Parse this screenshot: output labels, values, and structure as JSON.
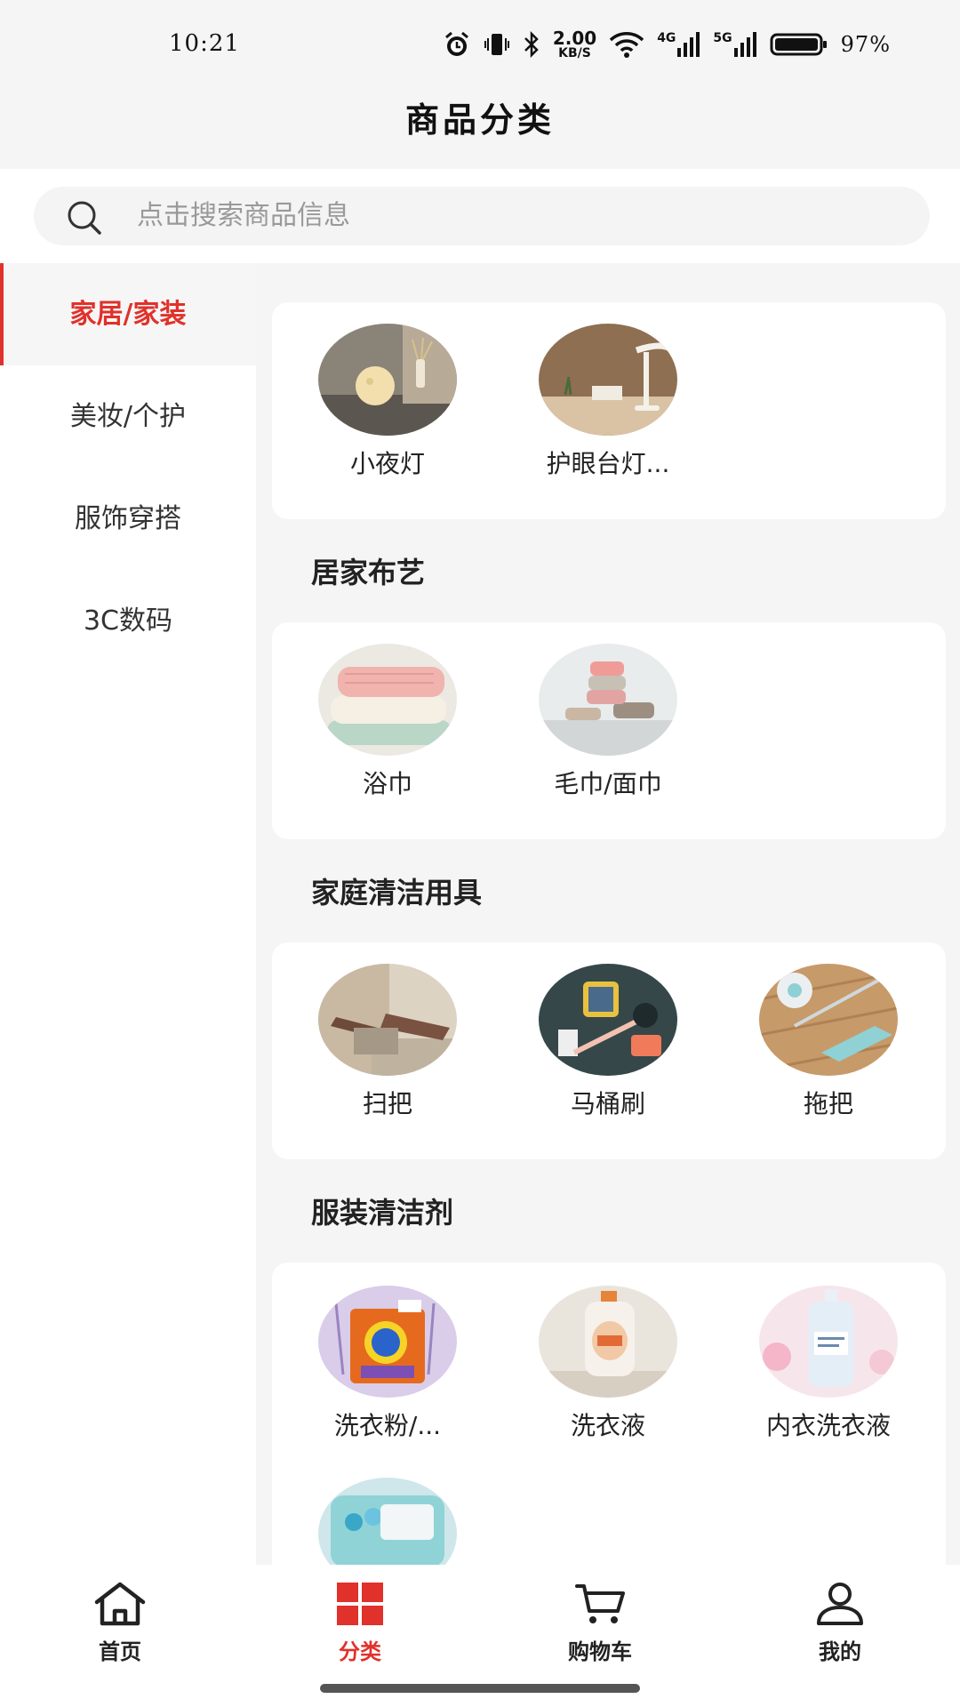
{
  "status_bar": {
    "time": "10:21",
    "net_speed_value": "2.00",
    "net_speed_unit": "KB/S",
    "net1": "4G",
    "net2": "5G",
    "battery": "97%"
  },
  "header": {
    "title": "商品分类"
  },
  "search": {
    "placeholder": "点击搜索商品信息"
  },
  "sidebar": {
    "items": [
      {
        "label": "家居/家装",
        "active": true
      },
      {
        "label": "美妆/个护",
        "active": false
      },
      {
        "label": "服饰穿搭",
        "active": false
      },
      {
        "label": "3C数码",
        "active": false
      }
    ]
  },
  "content": {
    "sections": [
      {
        "title": "",
        "items": [
          {
            "label": "小夜灯"
          },
          {
            "label": "护眼台灯..."
          }
        ]
      },
      {
        "title": "居家布艺",
        "items": [
          {
            "label": "浴巾"
          },
          {
            "label": "毛巾/面巾"
          }
        ]
      },
      {
        "title": "家庭清洁用具",
        "items": [
          {
            "label": "扫把"
          },
          {
            "label": "马桶刷"
          },
          {
            "label": "拖把"
          }
        ]
      },
      {
        "title": "服装清洁剂",
        "items": [
          {
            "label": "洗衣粉/..."
          },
          {
            "label": "洗衣液"
          },
          {
            "label": "内衣洗衣液"
          },
          {
            "label": ""
          }
        ]
      }
    ]
  },
  "bottom_nav": {
    "items": [
      {
        "label": "首页",
        "icon": "home-icon"
      },
      {
        "label": "分类",
        "icon": "category-icon",
        "active": true
      },
      {
        "label": "购物车",
        "icon": "cart-icon"
      },
      {
        "label": "我的",
        "icon": "user-icon"
      }
    ]
  },
  "colors": {
    "accent": "#e0312b",
    "background": "#f5f5f5"
  }
}
